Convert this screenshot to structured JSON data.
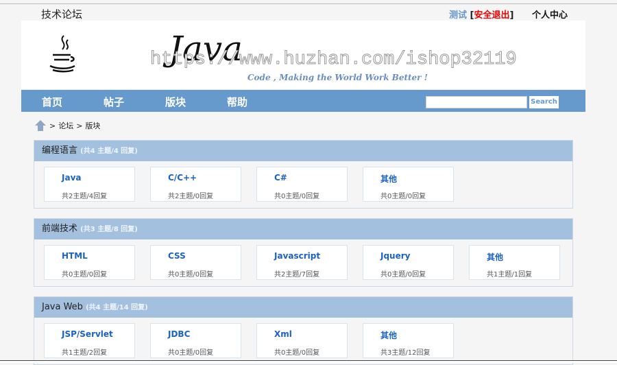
{
  "site_title": "技术论坛",
  "user": {
    "name": "测试",
    "open": "[",
    "logout": "安全退出",
    "close": "]",
    "center": "个人中心"
  },
  "banner": {
    "logo_text": "Java",
    "watermark": "https://www.huzhan.com/ishop32119",
    "slogan": "Code , Making the World Work Better !"
  },
  "nav": {
    "items": [
      "首页",
      "帖子",
      "版块",
      "帮助"
    ],
    "search_placeholder": "",
    "search_label": "Search"
  },
  "breadcrumb": {
    "sep1": ">",
    "forum": "论坛",
    "sep2": ">",
    "current": "版块"
  },
  "sections": [
    {
      "title": "编程语言",
      "count": "(共4 主题/4 回复)",
      "boards": [
        {
          "name": "Java",
          "stats": "共2主题/4回复"
        },
        {
          "name": "C/C++",
          "stats": "共2主题/0回复"
        },
        {
          "name": "C#",
          "stats": "共0主题/0回复"
        },
        {
          "name": "其他",
          "stats": "共0主题/0回复"
        }
      ]
    },
    {
      "title": "前端技术",
      "count": "(共3 主题/8 回复)",
      "boards": [
        {
          "name": "HTML",
          "stats": "共0主题/0回复"
        },
        {
          "name": "CSS",
          "stats": "共0主题/0回复"
        },
        {
          "name": "Javascript",
          "stats": "共2主题/7回复"
        },
        {
          "name": "Jquery",
          "stats": "共0主题/0回复"
        },
        {
          "name": "其他",
          "stats": "共1主题/1回复"
        }
      ]
    },
    {
      "title": "Java Web",
      "count": "(共4 主题/14 回复)",
      "boards": [
        {
          "name": "JSP/Servlet",
          "stats": "共1主题/2回复"
        },
        {
          "name": "JDBC",
          "stats": "共0主题/0回复"
        },
        {
          "name": "Xml",
          "stats": "共0主题/0回复"
        },
        {
          "name": "其他",
          "stats": "共3主题/12回复"
        }
      ]
    }
  ]
}
